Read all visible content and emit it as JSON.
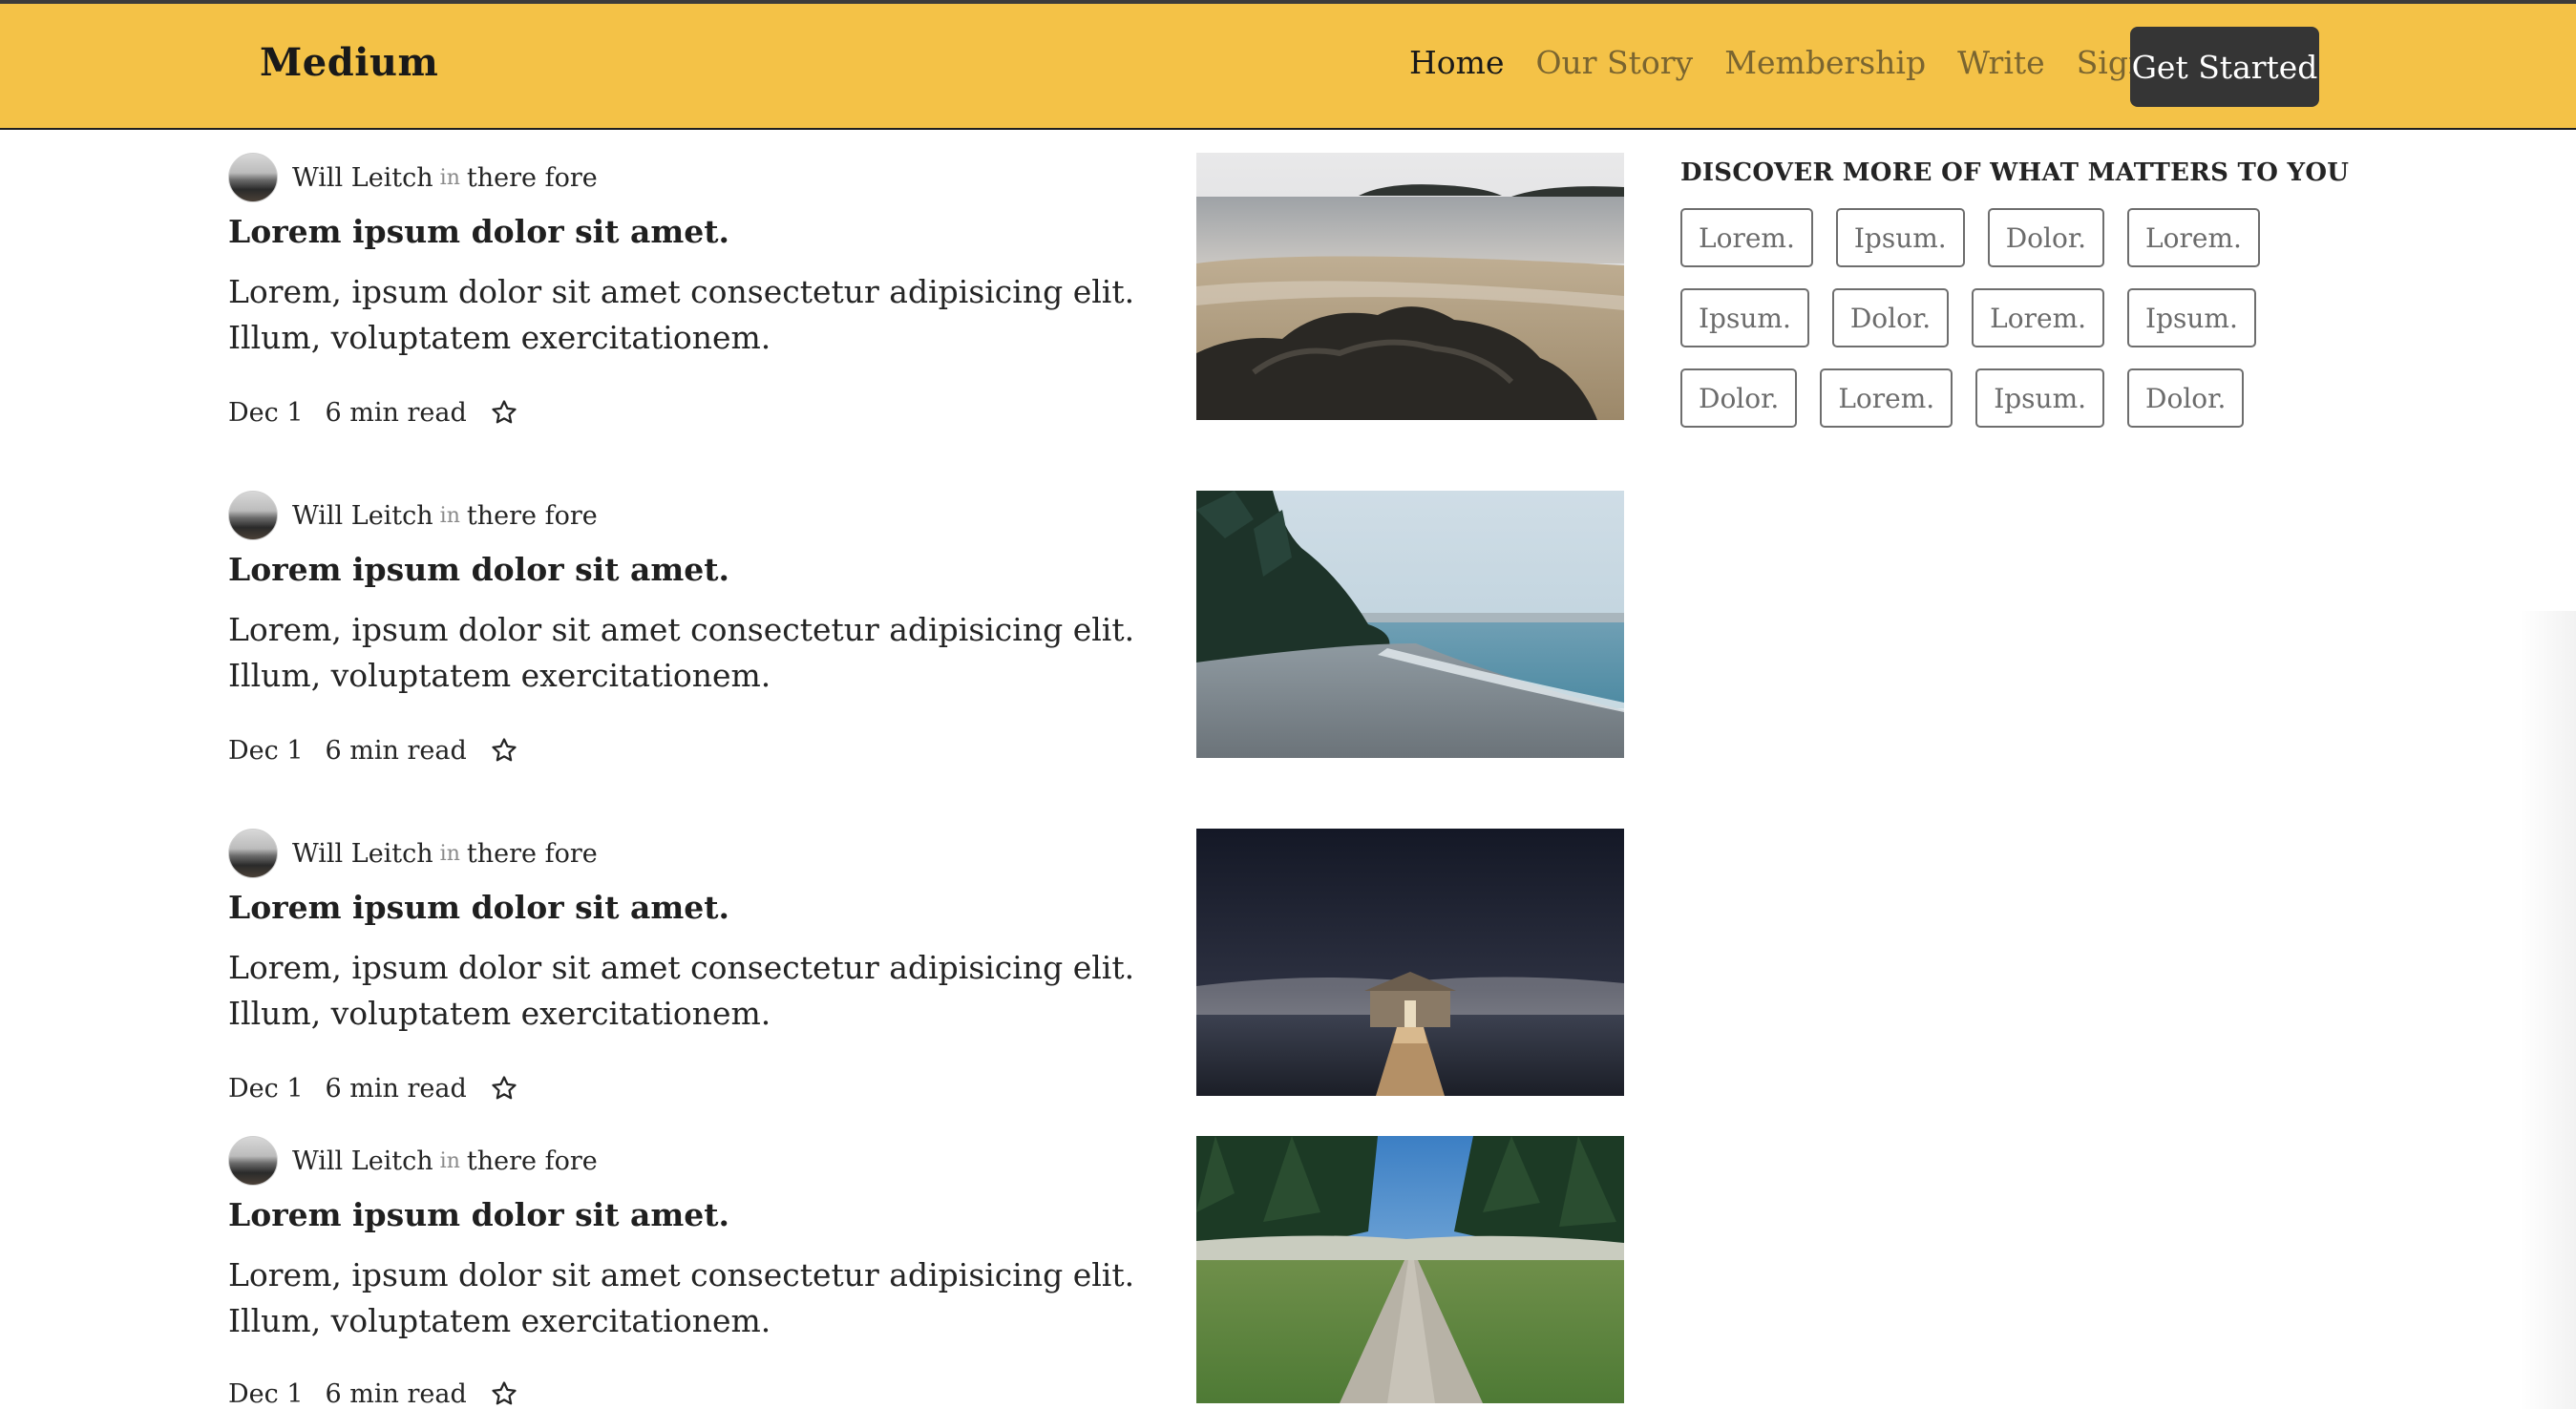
{
  "header": {
    "logo": "Medium",
    "nav": [
      {
        "label": "Home",
        "active": true
      },
      {
        "label": "Our Story",
        "active": false
      },
      {
        "label": "Membership",
        "active": false
      },
      {
        "label": "Write",
        "active": false
      },
      {
        "label": "Sign In",
        "active": false
      }
    ],
    "cta": "Get Started",
    "background_color": "#f4c247"
  },
  "posts": [
    {
      "author": "Will Leitch",
      "in": "in",
      "publication": "there fore",
      "title": "Lorem ipsum dolor sit amet.",
      "excerpt": "Lorem, ipsum dolor sit amet consectetur adipisicing elit. Illum, voluptatem exercitationem.",
      "date": "Dec 1",
      "read_time": "6 min read",
      "image": "beach-rocks-photo"
    },
    {
      "author": "Will Leitch",
      "in": "in",
      "publication": "there fore",
      "title": "Lorem ipsum dolor sit amet.",
      "excerpt": "Lorem, ipsum dolor sit amet consectetur adipisicing elit. Illum, voluptatem exercitationem.",
      "date": "Dec 1",
      "read_time": "6 min read",
      "image": "pebble-shore-photo"
    },
    {
      "author": "Will Leitch",
      "in": "in",
      "publication": "there fore",
      "title": "Lorem ipsum dolor sit amet.",
      "excerpt": "Lorem, ipsum dolor sit amet consectetur adipisicing elit. Illum, voluptatem exercitationem.",
      "date": "Dec 1",
      "read_time": "6 min read",
      "image": "boathouse-night-photo"
    },
    {
      "author": "Will Leitch",
      "in": "in",
      "publication": "there fore",
      "title": "Lorem ipsum dolor sit amet.",
      "excerpt": "Lorem, ipsum dolor sit amet consectetur adipisicing elit. Illum, voluptatem exercitationem.",
      "date": "Dec 1",
      "read_time": "6 min read",
      "image": "forest-path-photo"
    }
  ],
  "sidebar": {
    "title": "DISCOVER MORE OF WHAT MATTERS TO YOU",
    "tag_rows": [
      [
        "Lorem.",
        "Ipsum.",
        "Dolor.",
        "Lorem."
      ],
      [
        "Ipsum.",
        "Dolor.",
        "Lorem.",
        "Ipsum."
      ],
      [
        "Dolor.",
        "Lorem.",
        "Ipsum.",
        "Dolor."
      ]
    ]
  }
}
